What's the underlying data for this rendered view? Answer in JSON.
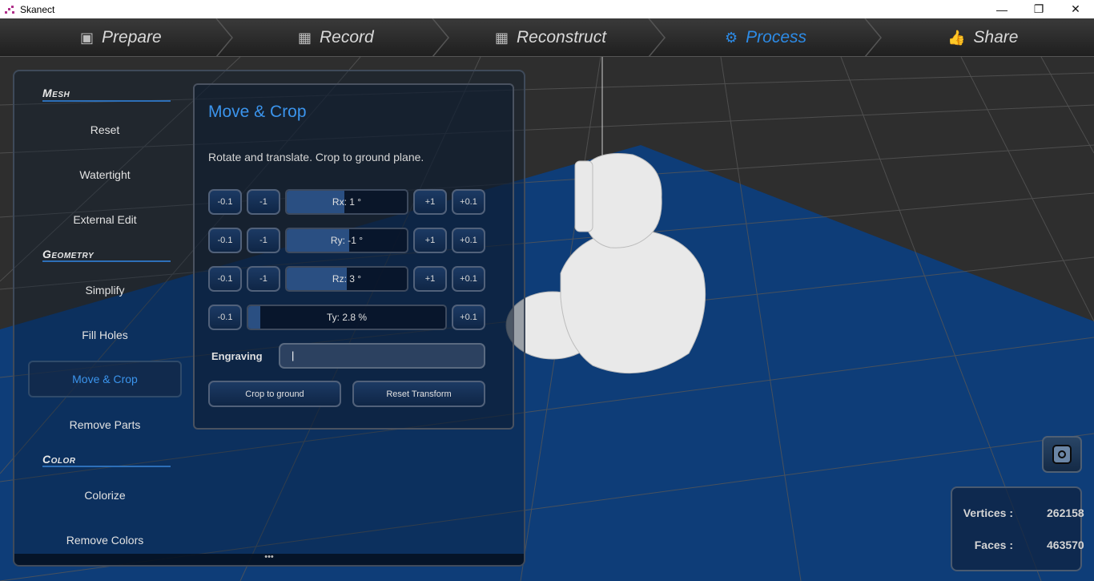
{
  "window": {
    "title": "Skanect",
    "controls": [
      "—",
      "❐",
      "✕"
    ]
  },
  "nav": {
    "tabs": [
      {
        "label": "Prepare",
        "icon": "presentation-icon"
      },
      {
        "label": "Record",
        "icon": "film-icon"
      },
      {
        "label": "Reconstruct",
        "icon": "film-icon"
      },
      {
        "label": "Process",
        "icon": "gears-icon"
      },
      {
        "label": "Share",
        "icon": "thumbs-up-icon"
      }
    ],
    "active": "Process"
  },
  "sidebar": {
    "sections": [
      {
        "title": "Mesh",
        "items": [
          "Reset",
          "Watertight",
          "External Edit"
        ]
      },
      {
        "title": "Geometry",
        "items": [
          "Simplify",
          "Fill Holes",
          "Move & Crop",
          "Remove Parts"
        ]
      },
      {
        "title": "Color",
        "items": [
          "Colorize",
          "Remove Colors"
        ]
      }
    ],
    "selected": "Move & Crop",
    "more": "•••"
  },
  "panel": {
    "title": "Move & Crop",
    "description": "Rotate and translate. Crop to ground plane.",
    "step_labels": {
      "minus_small": "-0.1",
      "minus_big": "-1",
      "plus_big": "+1",
      "plus_small": "+0.1"
    },
    "rotations": [
      {
        "label": "Rx: 1 °",
        "value_fraction": 0.48
      },
      {
        "label": "Ry: -1 °",
        "value_fraction": 0.52
      },
      {
        "label": "Rz: 3 °",
        "value_fraction": 0.5
      }
    ],
    "translation": {
      "label": "Ty: 2.8 %",
      "value_fraction": 0.06
    },
    "engraving": {
      "label": "Engraving",
      "value": "|"
    },
    "buttons": {
      "crop": "Crop to ground",
      "reset": "Reset Transform"
    }
  },
  "stats": {
    "vertices_label": "Vertices :",
    "vertices": "262158",
    "faces_label": "Faces :",
    "faces": "463570"
  },
  "colors": {
    "accent": "#2d8be6",
    "floor": "#0e3d78",
    "grid": "#555555"
  }
}
